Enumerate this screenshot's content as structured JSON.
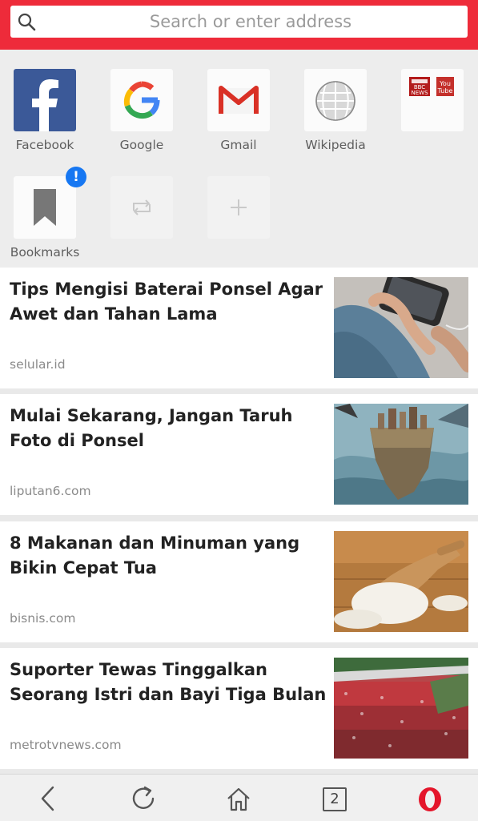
{
  "search": {
    "placeholder": "Search or enter address"
  },
  "speed_dial": {
    "tiles": [
      {
        "label": "Facebook",
        "icon": "facebook-icon"
      },
      {
        "label": "Google",
        "icon": "google-icon"
      },
      {
        "label": "Gmail",
        "icon": "gmail-icon"
      },
      {
        "label": "Wikipedia",
        "icon": "wikipedia-icon"
      },
      {
        "label": "",
        "icon": "bbc-youtube-folder-icon",
        "mini_labels": [
          "BBC NEWS",
          "You Tube"
        ]
      },
      {
        "label": "Bookmarks",
        "icon": "bookmark-icon",
        "badge": "!"
      },
      {
        "label": "",
        "icon": "sync-icon"
      },
      {
        "label": "",
        "icon": "plus-icon"
      }
    ]
  },
  "news": [
    {
      "title": "Tips Mengisi Baterai Ponsel Agar Awet dan Tahan Lama",
      "source": "selular.id",
      "image": "phone-charging-photo"
    },
    {
      "title": "Mulai Sekarang, Jangan Taruh Foto di Ponsel",
      "source": "liputan6.com",
      "image": "floating-city-photo"
    },
    {
      "title": "8 Makanan dan Minuman yang Bikin Cepat Tua",
      "source": "bisnis.com",
      "image": "rice-scoop-photo"
    },
    {
      "title": "Suporter Tewas Tinggalkan Seorang Istri dan Bayi Tiga Bulan",
      "source": "metrotvnews.com",
      "image": "stadium-crowd-photo"
    }
  ],
  "bottom_nav": {
    "tab_count": "2"
  },
  "colors": {
    "brand_red": "#ee2b3a",
    "badge_blue": "#1677f2"
  }
}
